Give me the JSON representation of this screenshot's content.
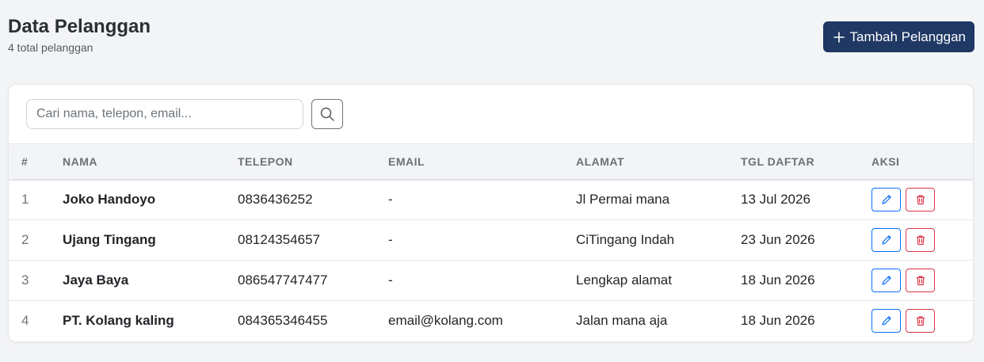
{
  "header": {
    "title": "Data Pelanggan",
    "subtitle": "4 total pelanggan",
    "add_button_label": "Tambah Pelanggan"
  },
  "search": {
    "placeholder": "Cari nama, telepon, email...",
    "value": ""
  },
  "table": {
    "columns": [
      "#",
      "NAMA",
      "TELEPON",
      "EMAIL",
      "ALAMAT",
      "TGL DAFTAR",
      "AKSI"
    ],
    "rows": [
      {
        "no": "1",
        "nama": "Joko Handoyo",
        "telepon": "0836436252",
        "email": "-",
        "alamat": "Jl Permai mana",
        "tgl": "13 Jul 2026"
      },
      {
        "no": "2",
        "nama": "Ujang Tingang",
        "telepon": "08124354657",
        "email": "-",
        "alamat": "CiTingang Indah",
        "tgl": "23 Jun 2026"
      },
      {
        "no": "3",
        "nama": "Jaya Baya",
        "telepon": "086547747477",
        "email": "-",
        "alamat": "Lengkap alamat",
        "tgl": "18 Jun 2026"
      },
      {
        "no": "4",
        "nama": "PT. Kolang kaling",
        "telepon": "084365346455",
        "email": "email@kolang.com",
        "alamat": "Jalan mana aja",
        "tgl": "18 Jun 2026"
      }
    ]
  },
  "icons": {
    "add": "plus-icon",
    "search": "search-icon",
    "edit": "pencil-icon",
    "delete": "trash-icon"
  },
  "colors": {
    "primary": "#1f3864",
    "edit": "#0d6efd",
    "delete": "#dc3545"
  }
}
